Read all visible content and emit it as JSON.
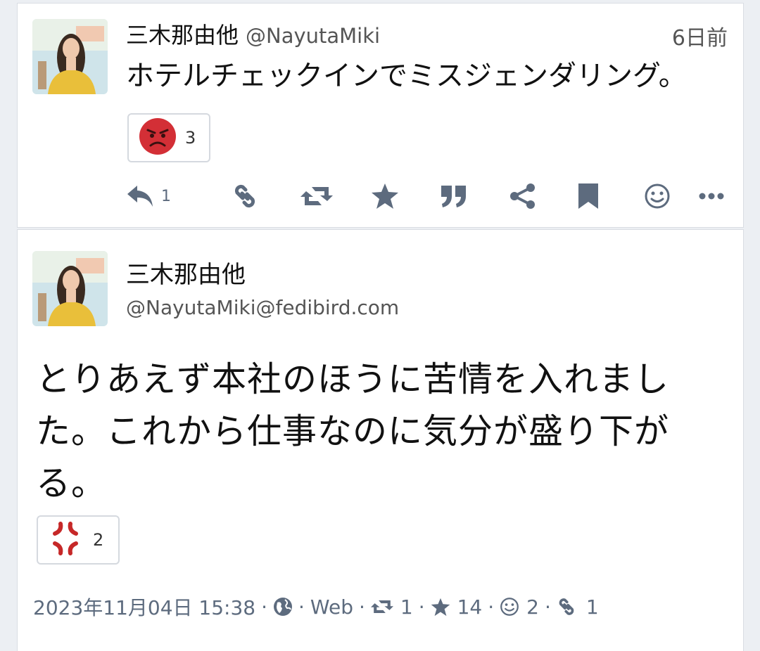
{
  "post1": {
    "display_name": "三木那由他",
    "handle": "@NayutaMiki",
    "time": "6日前",
    "text": "ホテルチェックインでミスジェンダリング。",
    "reaction": {
      "emoji": "angry-face-icon",
      "count": "3"
    },
    "actions": {
      "reply_count": "1"
    }
  },
  "post2": {
    "display_name": "三木那由他",
    "account": "@NayutaMiki@fedibird.com",
    "text": "とりあえず本社のほうに苦情を入れました。これから仕事なのに気分が盛り下がる。",
    "reaction": {
      "emoji": "anger-symbol-icon",
      "count": "2"
    },
    "meta": {
      "datetime": "2023年11月04日 15:38",
      "separator": "·",
      "app": "Web",
      "boosts": "1",
      "favourites": "14",
      "reactions": "2",
      "references": "1"
    }
  },
  "colors": {
    "icon": "#5d6b7e",
    "reaction_red": "#d32f36",
    "background": "#eceff3"
  }
}
